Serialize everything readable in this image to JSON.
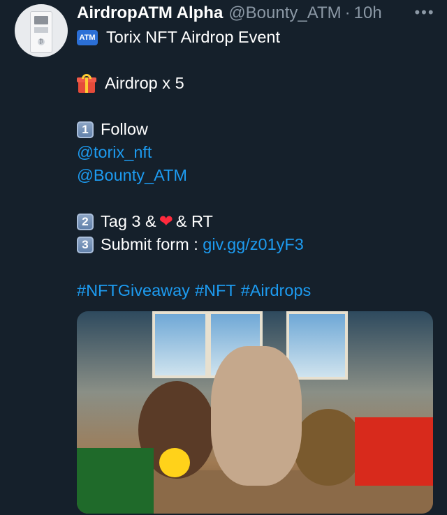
{
  "author": {
    "display_name": "AirdropATM Alpha",
    "handle": "@Bounty_ATM",
    "separator": "·",
    "timestamp": "10h",
    "avatar_icon": "atm-machine-icon"
  },
  "more_label": "•••",
  "tweet": {
    "line1_badge": "ATM",
    "line1_text": "Torix NFT Airdrop Event",
    "line2_text": "Airdrop x 5",
    "step1_key": "1",
    "step1_text": "Follow",
    "mention1": "@torix_nft",
    "mention2": "@Bounty_ATM",
    "step2_key": "2",
    "step2_text_a": "Tag 3 &",
    "step2_heart": "❤",
    "step2_text_b": "& RT",
    "step3_key": "3",
    "step3_text": "Submit form : ",
    "step3_link": "giv.gg/z01yF3",
    "hashtags": [
      "#NFTGiveaway",
      "#NFT",
      "#Airdrops"
    ]
  },
  "media": {
    "description_icon": "image-plush-toys"
  },
  "colors": {
    "background": "#15202b",
    "text": "#ffffff",
    "secondary": "#8b98a5",
    "link": "#1d9bf0"
  }
}
